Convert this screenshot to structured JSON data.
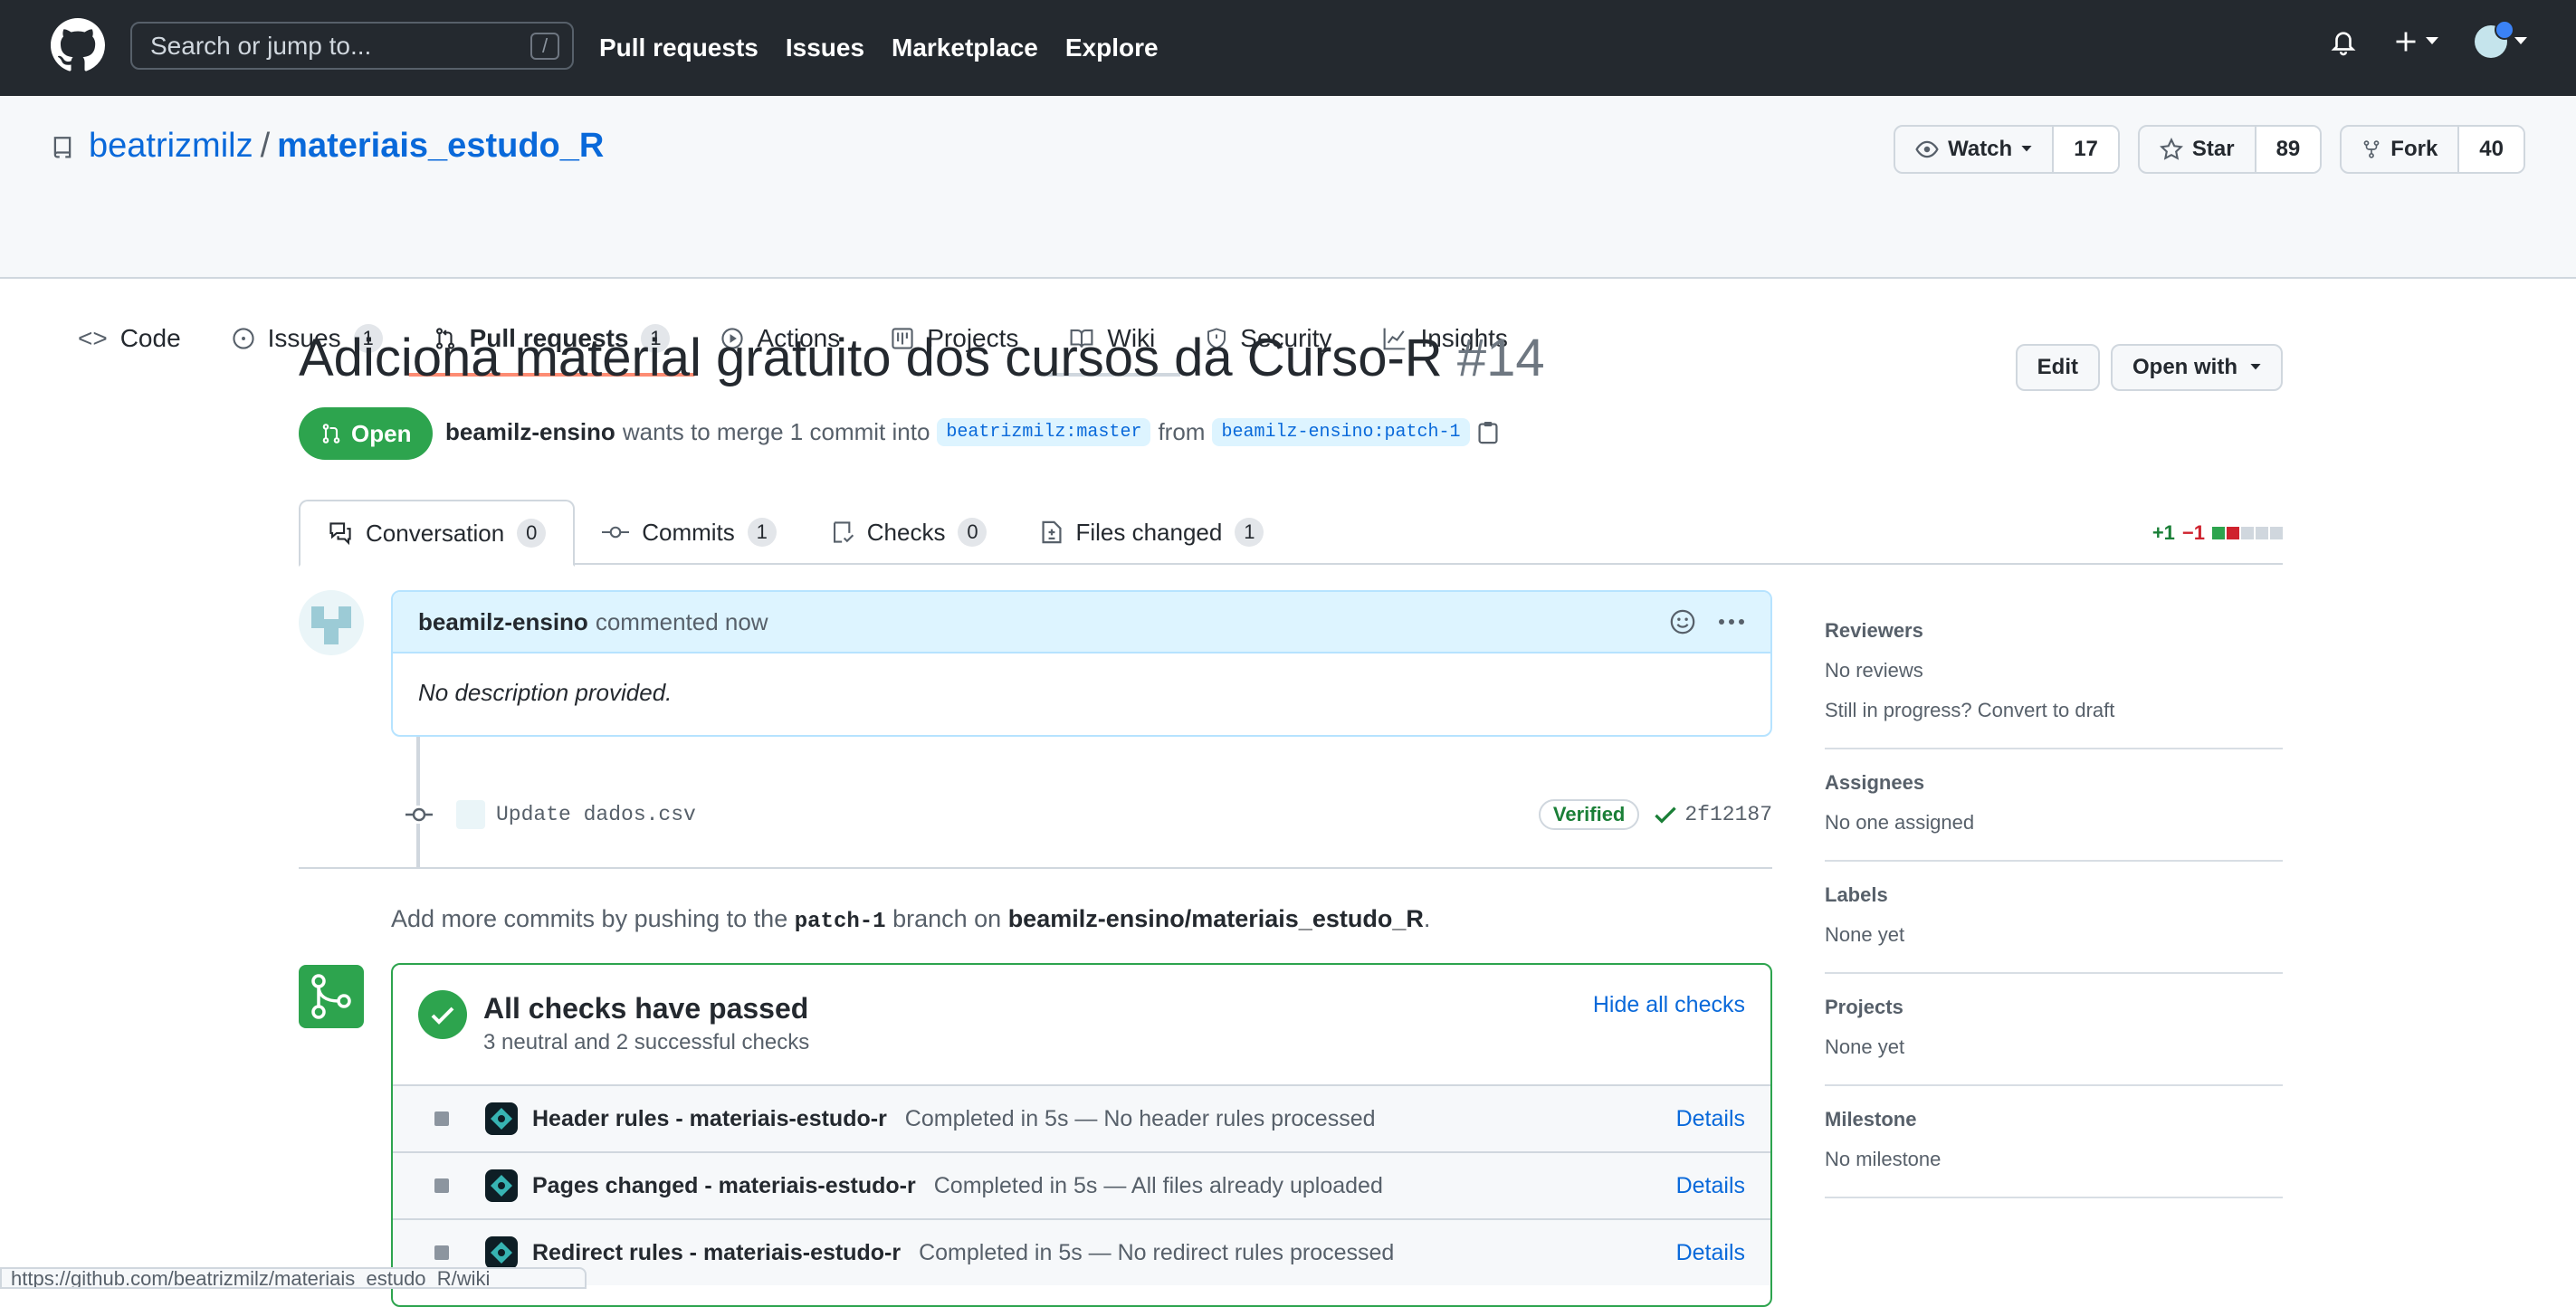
{
  "header": {
    "search_placeholder": "Search or jump to...",
    "search_key": "/",
    "nav": [
      "Pull requests",
      "Issues",
      "Marketplace",
      "Explore"
    ]
  },
  "repo": {
    "owner": "beatrizmilz",
    "sep": "/",
    "name": "materiais_estudo_R",
    "watch": "Watch",
    "watch_count": "17",
    "star": "Star",
    "star_count": "89",
    "fork": "Fork",
    "fork_count": "40"
  },
  "tabs": [
    {
      "label": "Code"
    },
    {
      "label": "Issues",
      "count": "1"
    },
    {
      "label": "Pull requests",
      "count": "1"
    },
    {
      "label": "Actions"
    },
    {
      "label": "Projects"
    },
    {
      "label": "Wiki"
    },
    {
      "label": "Security"
    },
    {
      "label": "Insights"
    }
  ],
  "pr": {
    "title": "Adiciona material gratuito dos cursos da Curso-R",
    "number": "#14",
    "edit": "Edit",
    "open_with": "Open with",
    "state": "Open",
    "author": "beamilz-ensino",
    "merge_text": "wants to merge 1 commit into",
    "base": "beatrizmilz:master",
    "from": "from",
    "head": "beamilz-ensino:patch-1"
  },
  "prtabs": [
    {
      "label": "Conversation",
      "count": "0"
    },
    {
      "label": "Commits",
      "count": "1"
    },
    {
      "label": "Checks",
      "count": "0"
    },
    {
      "label": "Files changed",
      "count": "1"
    }
  ],
  "diffstat": {
    "add": "+1",
    "del": "−1"
  },
  "comment": {
    "author": "beamilz-ensino",
    "action": "commented now",
    "body": "No description provided."
  },
  "commit": {
    "message": "Update dados.csv",
    "verified": "Verified",
    "sha": "2f12187"
  },
  "addmore": {
    "t1": "Add more commits by pushing to the",
    "branch": "patch-1",
    "t2": "branch on",
    "repo": "beamilz-ensino/materiais_estudo_R",
    "t3": "."
  },
  "checks": {
    "title": "All checks have passed",
    "subtitle": "3 neutral and 2 successful checks",
    "hide": "Hide all checks",
    "rows": [
      {
        "name": "Header rules - materiais-estudo-r",
        "status": "Completed in 5s — No header rules processed",
        "details": "Details"
      },
      {
        "name": "Pages changed - materiais-estudo-r",
        "status": "Completed in 5s — All files already uploaded",
        "details": "Details"
      },
      {
        "name": "Redirect rules - materiais-estudo-r",
        "status": "Completed in 5s — No redirect rules processed",
        "details": "Details"
      }
    ]
  },
  "sidebar": {
    "reviewers": "Reviewers",
    "no_reviews": "No reviews",
    "convert": "Still in progress? Convert to draft",
    "assignees": "Assignees",
    "no_assignees": "No one assigned",
    "labels": "Labels",
    "no_labels": "None yet",
    "projects": "Projects",
    "no_projects": "None yet",
    "milestone": "Milestone",
    "no_milestone": "No milestone"
  },
  "statusbar": "https://github.com/beatrizmilz/materiais_estudo_R/wiki",
  "colors": {
    "green": "#2da44e",
    "blue": "#0969da",
    "dark": "#24292f",
    "red": "#cf222e"
  }
}
